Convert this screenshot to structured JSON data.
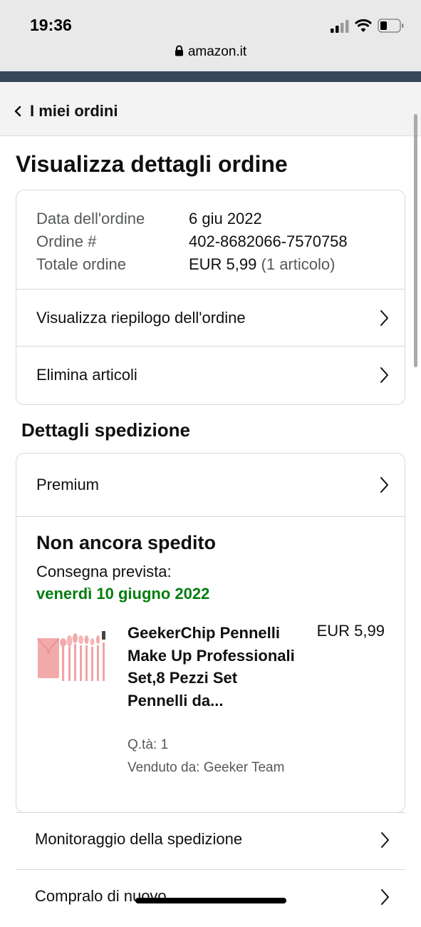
{
  "status_bar": {
    "time": "19:36",
    "url": "amazon.it"
  },
  "breadcrumb": {
    "back_label": "I miei ordini"
  },
  "page": {
    "title": "Visualizza dettagli ordine"
  },
  "order_summary": {
    "date_label": "Data dell'ordine",
    "date_value": "6 giu 2022",
    "number_label": "Ordine #",
    "number_value": "402-8682066-7570758",
    "total_label": "Totale ordine",
    "total_value": "EUR 5,99",
    "total_items": "(1 articolo)",
    "view_summary_label": "Visualizza riepilogo dell'ordine",
    "delete_items_label": "Elimina articoli"
  },
  "shipping": {
    "section_title": "Dettagli spedizione",
    "method_label": "Premium",
    "status": "Non ancora spedito",
    "expected_label": "Consegna prevista:",
    "expected_date": "venerdì 10 giugno 2022",
    "product": {
      "title": "GeekerChip Pennelli Make Up Professionali Set,8 Pezzi Set Pennelli da...",
      "price": "EUR 5,99",
      "quantity": "Q.tà: 1",
      "seller": "Venduto da: Geeker Team"
    }
  },
  "actions": {
    "track_label": "Monitoraggio della spedizione",
    "buy_again_label": "Compralo di nuovo"
  },
  "colors": {
    "delivery_green": "#067d0f",
    "nav_strip": "#37475a",
    "product_pink": "#f2a9aa"
  }
}
